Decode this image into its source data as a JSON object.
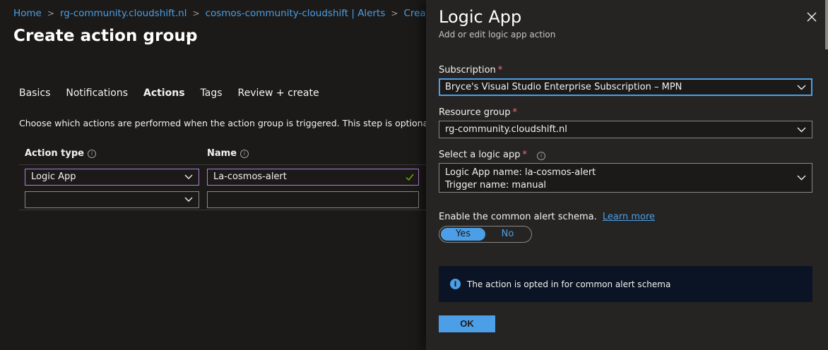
{
  "breadcrumb": {
    "items": [
      "Home",
      "rg-community.cloudshift.nl",
      "cosmos-community-cloudshift | Alerts",
      "Create an alert rule"
    ]
  },
  "page": {
    "title": "Create action group",
    "more": "···"
  },
  "tabs": [
    "Basics",
    "Notifications",
    "Actions",
    "Tags",
    "Review + create"
  ],
  "description": "Choose which actions are performed when the action group is triggered. This step is optional.",
  "table": {
    "headers": {
      "action_type": "Action type",
      "name": "Name"
    },
    "rows": [
      {
        "action_type": "Logic App",
        "name": "La-cosmos-alert"
      },
      {
        "action_type": "",
        "name": ""
      }
    ]
  },
  "panel": {
    "title": "Logic App",
    "subtitle": "Add or edit logic app action",
    "subscription": {
      "label": "Subscription",
      "value": "Bryce's Visual Studio Enterprise Subscription – MPN"
    },
    "resource_group": {
      "label": "Resource group",
      "value": "rg-community.cloudshift.nl"
    },
    "logic_app": {
      "label": "Select a logic app",
      "line1": "Logic App name: la-cosmos-alert",
      "line2": "Trigger name: manual"
    },
    "schema": {
      "label": "Enable the common alert schema.",
      "learn_more": "Learn more",
      "yes": "Yes",
      "no": "No",
      "selected": "Yes"
    },
    "info_message": "The action is opted in for common alert schema",
    "ok_label": "OK",
    "required_mark": "*"
  },
  "colors": {
    "accent": "#4c9fe6",
    "required": "#f1707b",
    "active_border": "#b180d7"
  }
}
